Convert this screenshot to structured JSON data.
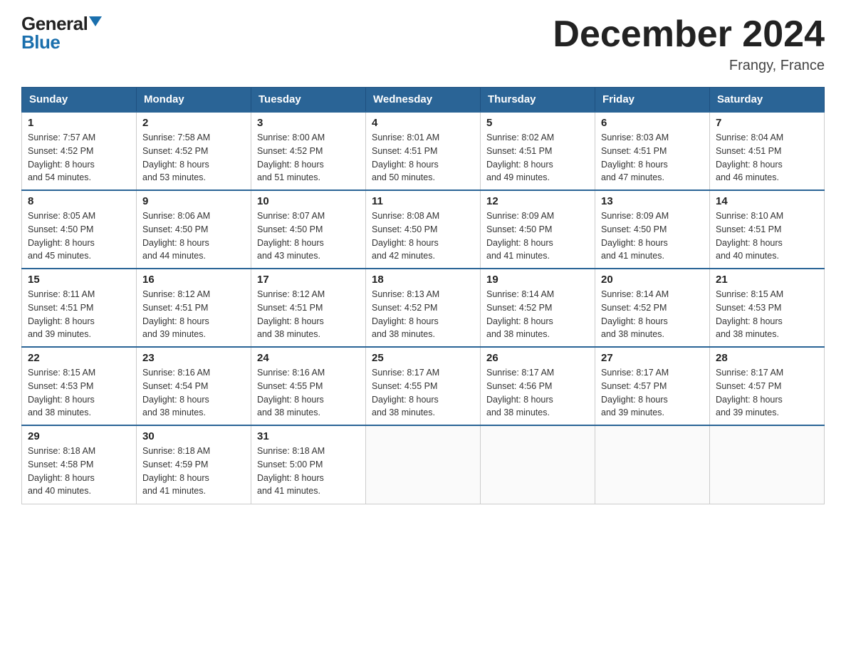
{
  "logo": {
    "line1": "General",
    "line2": "Blue"
  },
  "title": "December 2024",
  "location": "Frangy, France",
  "days_of_week": [
    "Sunday",
    "Monday",
    "Tuesday",
    "Wednesday",
    "Thursday",
    "Friday",
    "Saturday"
  ],
  "weeks": [
    [
      {
        "day": "1",
        "sunrise": "7:57 AM",
        "sunset": "4:52 PM",
        "daylight": "8 hours and 54 minutes."
      },
      {
        "day": "2",
        "sunrise": "7:58 AM",
        "sunset": "4:52 PM",
        "daylight": "8 hours and 53 minutes."
      },
      {
        "day": "3",
        "sunrise": "8:00 AM",
        "sunset": "4:52 PM",
        "daylight": "8 hours and 51 minutes."
      },
      {
        "day": "4",
        "sunrise": "8:01 AM",
        "sunset": "4:51 PM",
        "daylight": "8 hours and 50 minutes."
      },
      {
        "day": "5",
        "sunrise": "8:02 AM",
        "sunset": "4:51 PM",
        "daylight": "8 hours and 49 minutes."
      },
      {
        "day": "6",
        "sunrise": "8:03 AM",
        "sunset": "4:51 PM",
        "daylight": "8 hours and 47 minutes."
      },
      {
        "day": "7",
        "sunrise": "8:04 AM",
        "sunset": "4:51 PM",
        "daylight": "8 hours and 46 minutes."
      }
    ],
    [
      {
        "day": "8",
        "sunrise": "8:05 AM",
        "sunset": "4:50 PM",
        "daylight": "8 hours and 45 minutes."
      },
      {
        "day": "9",
        "sunrise": "8:06 AM",
        "sunset": "4:50 PM",
        "daylight": "8 hours and 44 minutes."
      },
      {
        "day": "10",
        "sunrise": "8:07 AM",
        "sunset": "4:50 PM",
        "daylight": "8 hours and 43 minutes."
      },
      {
        "day": "11",
        "sunrise": "8:08 AM",
        "sunset": "4:50 PM",
        "daylight": "8 hours and 42 minutes."
      },
      {
        "day": "12",
        "sunrise": "8:09 AM",
        "sunset": "4:50 PM",
        "daylight": "8 hours and 41 minutes."
      },
      {
        "day": "13",
        "sunrise": "8:09 AM",
        "sunset": "4:50 PM",
        "daylight": "8 hours and 41 minutes."
      },
      {
        "day": "14",
        "sunrise": "8:10 AM",
        "sunset": "4:51 PM",
        "daylight": "8 hours and 40 minutes."
      }
    ],
    [
      {
        "day": "15",
        "sunrise": "8:11 AM",
        "sunset": "4:51 PM",
        "daylight": "8 hours and 39 minutes."
      },
      {
        "day": "16",
        "sunrise": "8:12 AM",
        "sunset": "4:51 PM",
        "daylight": "8 hours and 39 minutes."
      },
      {
        "day": "17",
        "sunrise": "8:12 AM",
        "sunset": "4:51 PM",
        "daylight": "8 hours and 38 minutes."
      },
      {
        "day": "18",
        "sunrise": "8:13 AM",
        "sunset": "4:52 PM",
        "daylight": "8 hours and 38 minutes."
      },
      {
        "day": "19",
        "sunrise": "8:14 AM",
        "sunset": "4:52 PM",
        "daylight": "8 hours and 38 minutes."
      },
      {
        "day": "20",
        "sunrise": "8:14 AM",
        "sunset": "4:52 PM",
        "daylight": "8 hours and 38 minutes."
      },
      {
        "day": "21",
        "sunrise": "8:15 AM",
        "sunset": "4:53 PM",
        "daylight": "8 hours and 38 minutes."
      }
    ],
    [
      {
        "day": "22",
        "sunrise": "8:15 AM",
        "sunset": "4:53 PM",
        "daylight": "8 hours and 38 minutes."
      },
      {
        "day": "23",
        "sunrise": "8:16 AM",
        "sunset": "4:54 PM",
        "daylight": "8 hours and 38 minutes."
      },
      {
        "day": "24",
        "sunrise": "8:16 AM",
        "sunset": "4:55 PM",
        "daylight": "8 hours and 38 minutes."
      },
      {
        "day": "25",
        "sunrise": "8:17 AM",
        "sunset": "4:55 PM",
        "daylight": "8 hours and 38 minutes."
      },
      {
        "day": "26",
        "sunrise": "8:17 AM",
        "sunset": "4:56 PM",
        "daylight": "8 hours and 38 minutes."
      },
      {
        "day": "27",
        "sunrise": "8:17 AM",
        "sunset": "4:57 PM",
        "daylight": "8 hours and 39 minutes."
      },
      {
        "day": "28",
        "sunrise": "8:17 AM",
        "sunset": "4:57 PM",
        "daylight": "8 hours and 39 minutes."
      }
    ],
    [
      {
        "day": "29",
        "sunrise": "8:18 AM",
        "sunset": "4:58 PM",
        "daylight": "8 hours and 40 minutes."
      },
      {
        "day": "30",
        "sunrise": "8:18 AM",
        "sunset": "4:59 PM",
        "daylight": "8 hours and 41 minutes."
      },
      {
        "day": "31",
        "sunrise": "8:18 AM",
        "sunset": "5:00 PM",
        "daylight": "8 hours and 41 minutes."
      },
      null,
      null,
      null,
      null
    ]
  ],
  "labels": {
    "sunrise": "Sunrise:",
    "sunset": "Sunset:",
    "daylight": "Daylight:"
  }
}
